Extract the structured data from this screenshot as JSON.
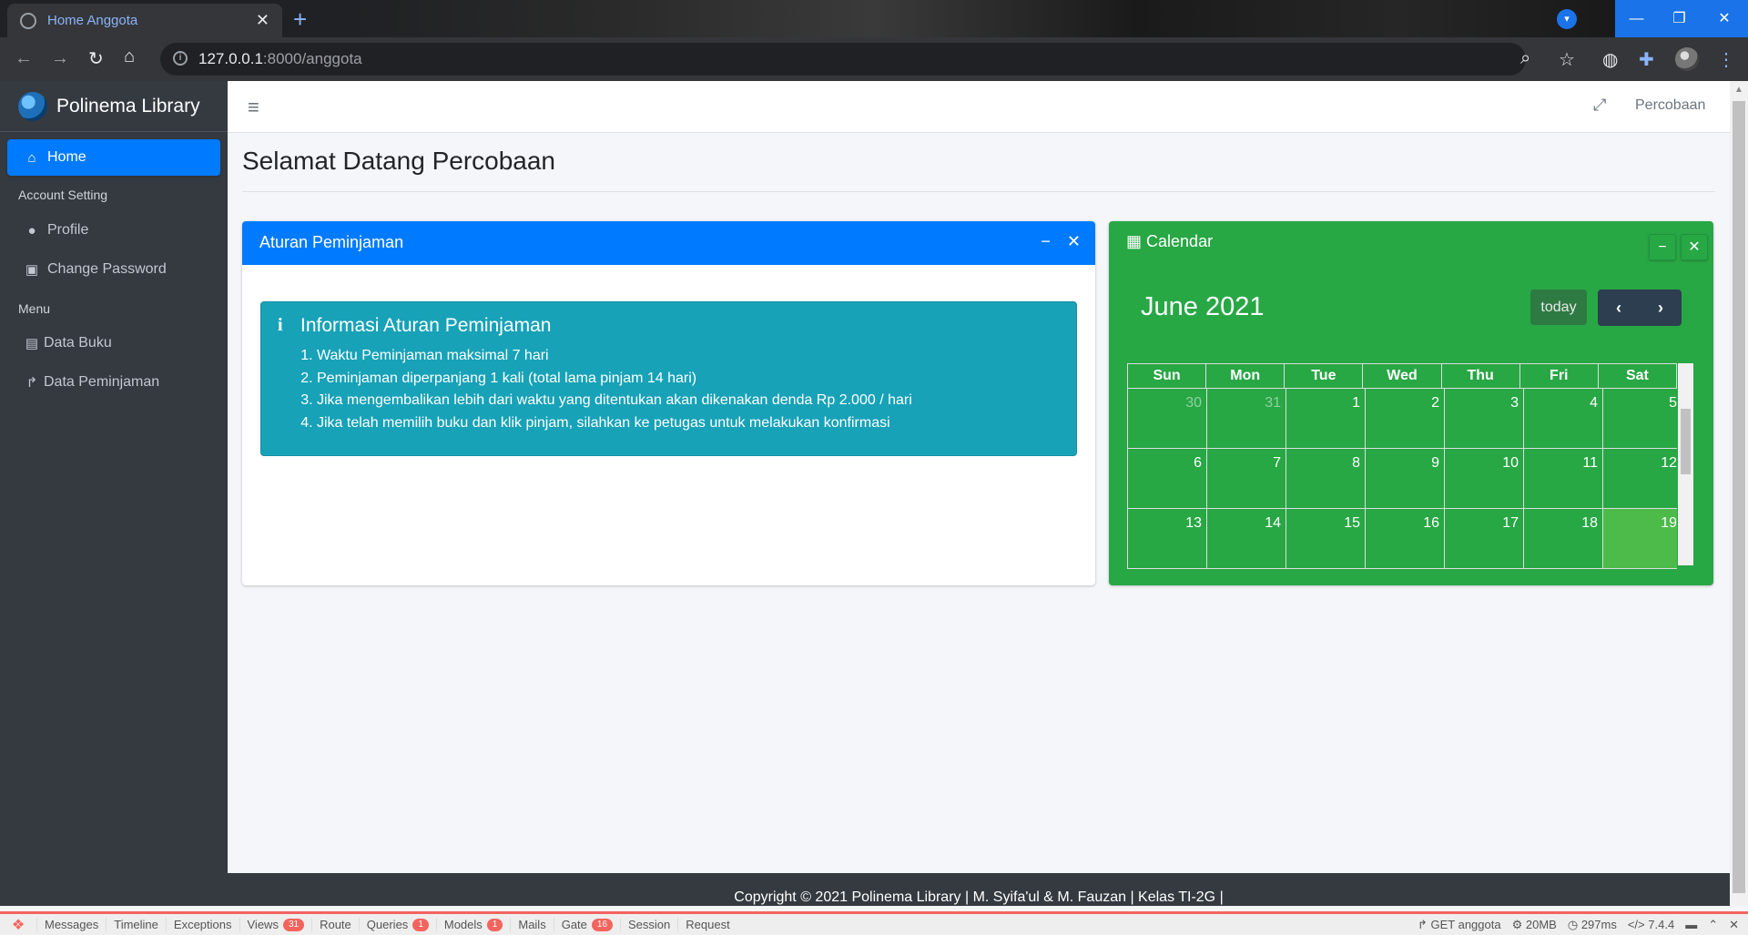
{
  "browser": {
    "tab_title": "Home Anggota",
    "url_host": "127.0.0.1",
    "url_path": ":8000/anggota"
  },
  "sidebar": {
    "brand": "Polinema Library",
    "items": [
      {
        "label": "Home",
        "icon": "home-icon"
      },
      {
        "label": "Profile",
        "icon": "user-icon"
      },
      {
        "label": "Change Password",
        "icon": "lock-icon"
      },
      {
        "label": "Data Buku",
        "icon": "book-icon"
      },
      {
        "label": "Data Peminjaman",
        "icon": "share-icon"
      }
    ],
    "headers": [
      "Account Setting",
      "Menu"
    ]
  },
  "topnav": {
    "user": "Percobaan"
  },
  "page": {
    "title": "Selamat Datang Percobaan"
  },
  "rules_card": {
    "title": "Aturan Peminjaman",
    "callout_title": "Informasi Aturan Peminjaman",
    "rules": [
      "Waktu Peminjaman maksimal 7 hari",
      "Peminjaman diperpanjang 1 kali (total lama pinjam 14 hari)",
      "Jika mengembalikan lebih dari waktu yang ditentukan akan dikenakan denda Rp 2.000 / hari",
      "Jika telah memilih buku dan klik pinjam, silahkan ke petugas untuk melakukan konfirmasi"
    ]
  },
  "calendar": {
    "card_title": "Calendar",
    "month_title": "June 2021",
    "today_label": "today",
    "weekdays": [
      "Sun",
      "Mon",
      "Tue",
      "Wed",
      "Thu",
      "Fri",
      "Sat"
    ],
    "weeks": [
      [
        "30",
        "31",
        "1",
        "2",
        "3",
        "4",
        "5"
      ],
      [
        "6",
        "7",
        "8",
        "9",
        "10",
        "11",
        "12"
      ],
      [
        "13",
        "14",
        "15",
        "16",
        "17",
        "18",
        "19"
      ]
    ],
    "colors": {
      "card": "#28a745",
      "today_cell": "#4cbb4a"
    }
  },
  "footer": {
    "text": "Copyright © 2021 Polinema Library | M. Syifa'ul & M. Fauzan | Kelas TI-2G |"
  },
  "debugbar": {
    "tabs": [
      {
        "label": "Messages"
      },
      {
        "label": "Timeline"
      },
      {
        "label": "Exceptions"
      },
      {
        "label": "Views",
        "badge": "31"
      },
      {
        "label": "Route"
      },
      {
        "label": "Queries",
        "badge": "1"
      },
      {
        "label": "Models",
        "badge": "1"
      },
      {
        "label": "Mails"
      },
      {
        "label": "Gate",
        "badge": "16"
      },
      {
        "label": "Session"
      },
      {
        "label": "Request"
      }
    ],
    "request": "GET anggota",
    "memory": "20MB",
    "time": "297ms",
    "php": "7.4.4"
  }
}
